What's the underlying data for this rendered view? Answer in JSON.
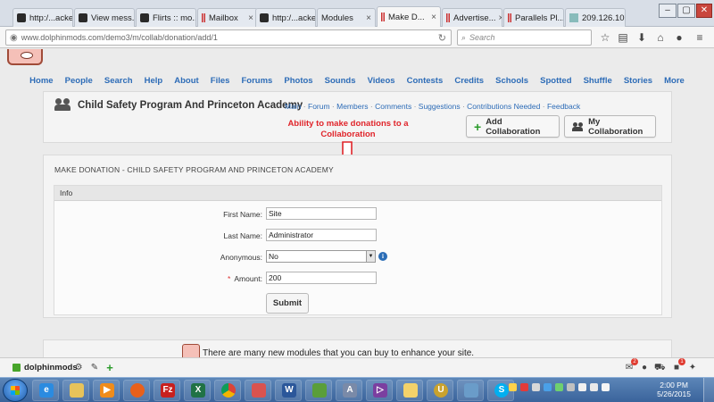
{
  "browser": {
    "tabs": [
      {
        "label": "http:/...acker",
        "icon": "dolphin-icon"
      },
      {
        "label": "View mess...",
        "icon": "dolphin-icon"
      },
      {
        "label": "Flirts :: mo...",
        "icon": "dolphin-icon"
      },
      {
        "label": "Mailbox",
        "icon": "parallels-icon"
      },
      {
        "label": "http:/...acker",
        "icon": "dolphin-icon"
      },
      {
        "label": "Modules",
        "icon": "none"
      },
      {
        "label": "Make D...",
        "icon": "parallels-icon"
      },
      {
        "label": "Advertise...",
        "icon": "parallels-icon"
      },
      {
        "label": "Parallels Pl...",
        "icon": "parallels-icon"
      },
      {
        "label": "209.126.10...",
        "icon": "image-icon"
      }
    ],
    "active_tab": 6,
    "url": "www.dolphinmods.com/demo3/m/collab/donation/add/1",
    "search_placeholder": "Search",
    "window_controls": [
      "–",
      "▢",
      "✕"
    ]
  },
  "site": {
    "nav": [
      "Home",
      "People",
      "Search",
      "Help",
      "About",
      "Files",
      "Forums",
      "Photos",
      "Sounds",
      "Videos",
      "Contests",
      "Credits",
      "Schools",
      "Spotted",
      "Shuffle",
      "Stories",
      "More"
    ],
    "context_title": "Child Safety Program And Princeton Academy",
    "submenu": [
      "Main",
      "Forum",
      "Members",
      "Comments",
      "Suggestions",
      "Contributions Needed",
      "Feedback"
    ],
    "add_collab_label": "Add Collaboration",
    "my_collab_label": "My Collaboration"
  },
  "annotation": {
    "line1": "Ability to make donations to a",
    "line2": "Collaboration",
    "color": "#e0242a"
  },
  "form": {
    "heading": "MAKE DONATION - CHILD SAFETY PROGRAM AND PRINCETON ACADEMY",
    "section": "Info",
    "first_name_label": "First Name:",
    "first_name_value": "Site",
    "last_name_label": "Last Name:",
    "last_name_value": "Administrator",
    "anonymous_label": "Anonymous:",
    "anonymous_value": "No",
    "amount_label": "Amount:",
    "amount_required": "*",
    "amount_value": "200",
    "submit_label": "Submit"
  },
  "promo": {
    "text": "There are many new modules that you can buy to enhance your site."
  },
  "bottombar": {
    "brand": "dolphinmods",
    "mail_badge": "2",
    "notify_badge": "1"
  },
  "taskbar": {
    "time": "2:00 PM",
    "date": "5/26/2015"
  },
  "colors": {
    "link": "#2d6cb7",
    "accent_green": "#47a52a"
  }
}
